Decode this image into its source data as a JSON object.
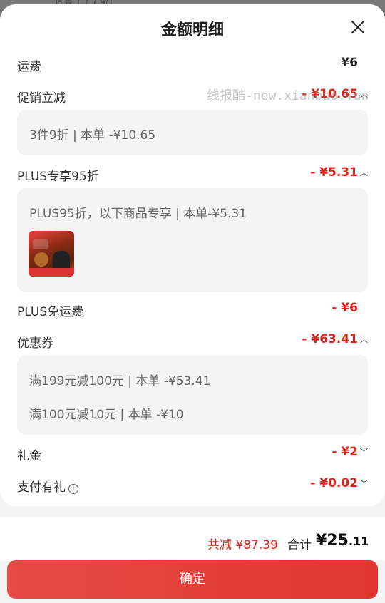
{
  "background_text": "同等  1.7      7.9/1",
  "sheet": {
    "title": "金额明细"
  },
  "watermark": "线报酷-new.xianbao.fun",
  "rows": {
    "shipping": {
      "label": "运费",
      "amount": "¥6"
    },
    "promo": {
      "label": "促销立减",
      "amount": "- ¥10.65",
      "detail": "3件9折 | 本单 -¥10.65"
    },
    "plus": {
      "label": "PLUS专享95折",
      "amount": "- ¥5.31",
      "detail": "PLUS95折，以下商品专享 | 本单-¥5.31"
    },
    "plus_ship": {
      "label": "PLUS免运费",
      "amount": "- ¥6"
    },
    "coupon": {
      "label": "优惠券",
      "amount": "- ¥63.41",
      "details": [
        "满199元减100元 | 本单 -¥53.41",
        "满100元减10元 | 本单 -¥10"
      ]
    },
    "gift": {
      "label": "礼金",
      "amount": "- ¥2"
    },
    "pay_gift": {
      "label": "支付有礼",
      "amount": "- ¥0.02"
    }
  },
  "summary": {
    "reduced": "共减 ¥87.39",
    "total_label": "合计",
    "total_main": "¥25",
    "total_decimal": ".11"
  },
  "confirm_button": "确定",
  "colors": {
    "accent": "#e2231a",
    "button": "#e3402f"
  },
  "icons": [
    "close-icon",
    "chevron-up-icon",
    "chevron-down-icon",
    "info-icon"
  ]
}
